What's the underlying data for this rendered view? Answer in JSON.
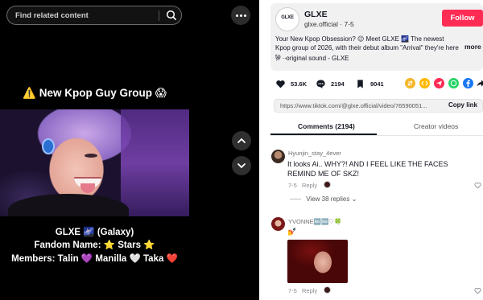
{
  "search": {
    "placeholder": "Find related content"
  },
  "video": {
    "title": "⚠️ New Kpop Guy Group 😱",
    "caption_lines": [
      "GLXE 🌌 (Galaxy)",
      "Fandom Name: ⭐ Stars ⭐",
      "Members: Talin 💜 Manilla 🤍 Taka ❤️"
    ]
  },
  "author": {
    "avatar_text": "GLXE",
    "name": "GLXE",
    "handle": "glxe.official",
    "separator": "·",
    "date": "7-5",
    "follow_label": "Follow"
  },
  "description": {
    "text": "Your New Kpop Obsession? 😉 Meet GLXE 🌌 The newest Kpop group of 2026, with their debut album \"Arrival\" they're here to ...",
    "more_label": "more"
  },
  "sound": {
    "icon": "♫",
    "label": "original sound - GLXE"
  },
  "actions": {
    "likes": "53.6K",
    "comments": "2194",
    "saves": "9041"
  },
  "share_icons": [
    {
      "name": "repost",
      "color": "#f5b72a"
    },
    {
      "name": "embed",
      "color": "#ffb800"
    },
    {
      "name": "friends",
      "color": "#fe2c55"
    },
    {
      "name": "send",
      "color": "#fe2c55"
    },
    {
      "name": "whatsapp",
      "color": "#25d366"
    },
    {
      "name": "facebook",
      "color": "#1877f2"
    },
    {
      "name": "share",
      "color": "#161823"
    }
  ],
  "link": {
    "url": "https://www.tiktok.com/@glxe.official/video/76590051...",
    "copy_label": "Copy link"
  },
  "tabs": {
    "comments": "Comments (2194)",
    "creator": "Creator videos"
  },
  "comments": [
    {
      "user": "Hyunjin_stay_4ever",
      "text": "It looks Ai.. WHY?! AND I FEEL LIKE THE FACES REMIND ME OF SKZ!",
      "date": "7-5",
      "reply_label": "Reply",
      "view_replies": "View 38 replies"
    },
    {
      "user": "YVONNE🆖🆖♡🍀",
      "text": "💅",
      "date": "7-5",
      "reply_label": "Reply"
    }
  ],
  "colors": {
    "follow": "#fe2c55",
    "text": "#161823",
    "muted": "#8a8b91"
  }
}
